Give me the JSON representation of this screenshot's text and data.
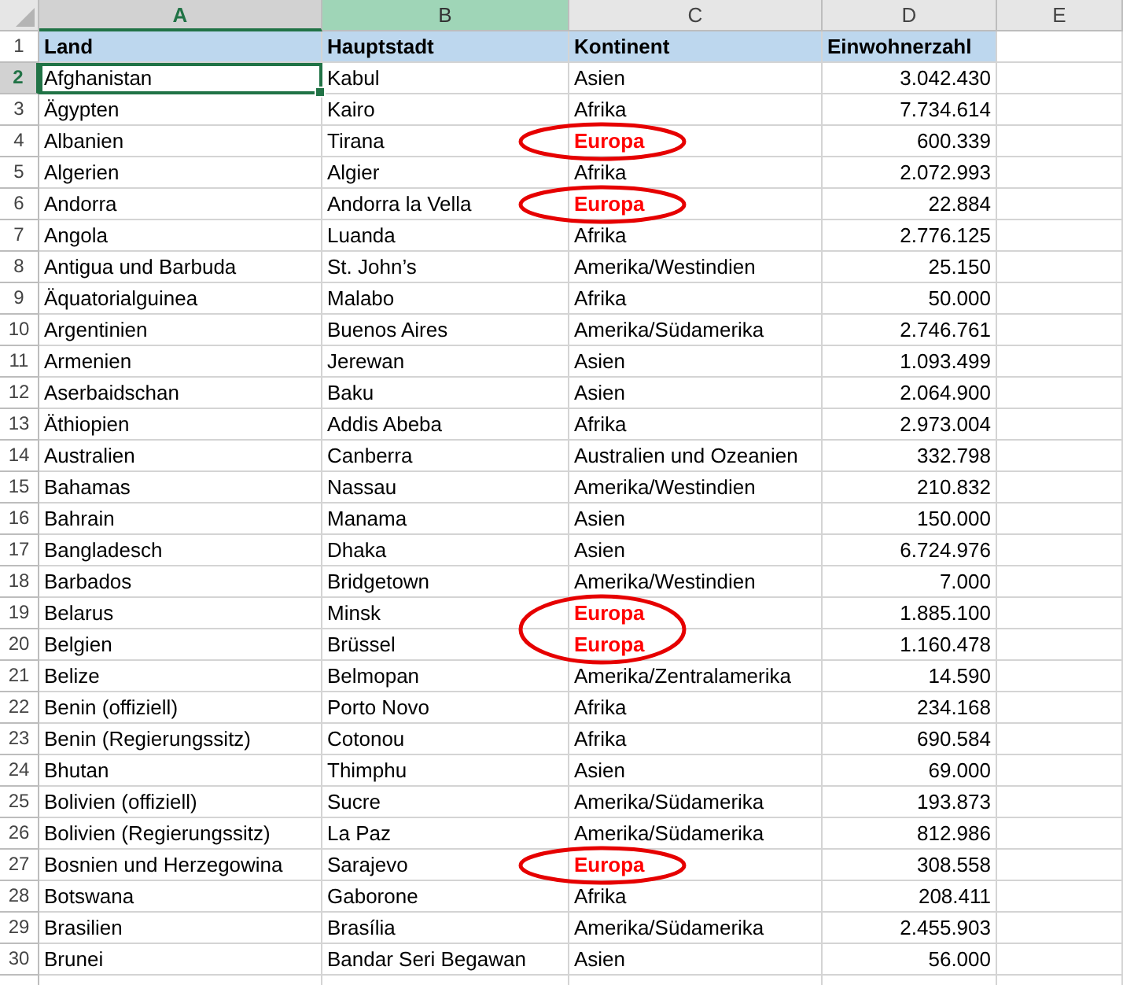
{
  "columns": [
    {
      "label": "A",
      "selected": true,
      "highlighted": false
    },
    {
      "label": "B",
      "selected": false,
      "highlighted": true
    },
    {
      "label": "C",
      "selected": false,
      "highlighted": false
    },
    {
      "label": "D",
      "selected": false,
      "highlighted": false
    },
    {
      "label": "E",
      "selected": false,
      "highlighted": false
    }
  ],
  "rows": [
    {
      "number": "1",
      "kind": "header",
      "selected": false,
      "cells": [
        "Land",
        "Hauptstadt",
        "Kontinent",
        "Einwohnerzahl"
      ]
    },
    {
      "number": "2",
      "kind": "data",
      "selected": true,
      "marked": false,
      "cells": [
        "Afghanistan",
        "Kabul",
        "Asien",
        "3.042.430"
      ]
    },
    {
      "number": "3",
      "kind": "data",
      "selected": false,
      "marked": false,
      "cells": [
        "Ägypten",
        "Kairo",
        "Afrika",
        "7.734.614"
      ]
    },
    {
      "number": "4",
      "kind": "data",
      "selected": false,
      "marked": true,
      "cells": [
        "Albanien",
        "Tirana",
        "Europa",
        "600.339"
      ]
    },
    {
      "number": "5",
      "kind": "data",
      "selected": false,
      "marked": false,
      "cells": [
        "Algerien",
        "Algier",
        "Afrika",
        "2.072.993"
      ]
    },
    {
      "number": "6",
      "kind": "data",
      "selected": false,
      "marked": true,
      "cells": [
        "Andorra",
        "Andorra la Vella",
        "Europa",
        "22.884"
      ]
    },
    {
      "number": "7",
      "kind": "data",
      "selected": false,
      "marked": false,
      "cells": [
        "Angola",
        "Luanda",
        "Afrika",
        "2.776.125"
      ]
    },
    {
      "number": "8",
      "kind": "data",
      "selected": false,
      "marked": false,
      "cells": [
        "Antigua und Barbuda",
        "St. John’s",
        "Amerika/Westindien",
        "25.150"
      ]
    },
    {
      "number": "9",
      "kind": "data",
      "selected": false,
      "marked": false,
      "cells": [
        "Äquatorialguinea",
        "Malabo",
        "Afrika",
        "50.000"
      ]
    },
    {
      "number": "10",
      "kind": "data",
      "selected": false,
      "marked": false,
      "cells": [
        "Argentinien",
        "Buenos Aires",
        "Amerika/Südamerika",
        "2.746.761"
      ]
    },
    {
      "number": "11",
      "kind": "data",
      "selected": false,
      "marked": false,
      "cells": [
        "Armenien",
        "Jerewan",
        "Asien",
        "1.093.499"
      ]
    },
    {
      "number": "12",
      "kind": "data",
      "selected": false,
      "marked": false,
      "cells": [
        "Aserbaidschan",
        "Baku",
        "Asien",
        "2.064.900"
      ]
    },
    {
      "number": "13",
      "kind": "data",
      "selected": false,
      "marked": false,
      "cells": [
        "Äthiopien",
        "Addis Abeba",
        "Afrika",
        "2.973.004"
      ]
    },
    {
      "number": "14",
      "kind": "data",
      "selected": false,
      "marked": false,
      "cells": [
        "Australien",
        "Canberra",
        "Australien und Ozeanien",
        "332.798"
      ]
    },
    {
      "number": "15",
      "kind": "data",
      "selected": false,
      "marked": false,
      "cells": [
        "Bahamas",
        "Nassau",
        "Amerika/Westindien",
        "210.832"
      ]
    },
    {
      "number": "16",
      "kind": "data",
      "selected": false,
      "marked": false,
      "cells": [
        "Bahrain",
        "Manama",
        "Asien",
        "150.000"
      ]
    },
    {
      "number": "17",
      "kind": "data",
      "selected": false,
      "marked": false,
      "cells": [
        "Bangladesch",
        "Dhaka",
        "Asien",
        "6.724.976"
      ]
    },
    {
      "number": "18",
      "kind": "data",
      "selected": false,
      "marked": false,
      "cells": [
        "Barbados",
        "Bridgetown",
        "Amerika/Westindien",
        "7.000"
      ]
    },
    {
      "number": "19",
      "kind": "data",
      "selected": false,
      "marked": true,
      "cells": [
        "Belarus",
        "Minsk",
        "Europa",
        "1.885.100"
      ]
    },
    {
      "number": "20",
      "kind": "data",
      "selected": false,
      "marked": true,
      "cells": [
        "Belgien",
        "Brüssel",
        "Europa",
        "1.160.478"
      ]
    },
    {
      "number": "21",
      "kind": "data",
      "selected": false,
      "marked": false,
      "cells": [
        "Belize",
        "Belmopan",
        "Amerika/Zentralamerika",
        "14.590"
      ]
    },
    {
      "number": "22",
      "kind": "data",
      "selected": false,
      "marked": false,
      "cells": [
        "Benin (offiziell)",
        "Porto Novo",
        "Afrika",
        "234.168"
      ]
    },
    {
      "number": "23",
      "kind": "data",
      "selected": false,
      "marked": false,
      "cells": [
        "Benin (Regierungssitz)",
        "Cotonou",
        "Afrika",
        "690.584"
      ]
    },
    {
      "number": "24",
      "kind": "data",
      "selected": false,
      "marked": false,
      "cells": [
        "Bhutan",
        "Thimphu",
        "Asien",
        "69.000"
      ]
    },
    {
      "number": "25",
      "kind": "data",
      "selected": false,
      "marked": false,
      "cells": [
        "Bolivien (offiziell)",
        "Sucre",
        "Amerika/Südamerika",
        "193.873"
      ]
    },
    {
      "number": "26",
      "kind": "data",
      "selected": false,
      "marked": false,
      "cells": [
        "Bolivien (Regierungssitz)",
        "La Paz",
        "Amerika/Südamerika",
        "812.986"
      ]
    },
    {
      "number": "27",
      "kind": "data",
      "selected": false,
      "marked": true,
      "cells": [
        "Bosnien und Herzegowina",
        "Sarajevo",
        "Europa",
        "308.558"
      ]
    },
    {
      "number": "28",
      "kind": "data",
      "selected": false,
      "marked": false,
      "cells": [
        "Botswana",
        "Gaborone",
        "Afrika",
        "208.411"
      ]
    },
    {
      "number": "29",
      "kind": "data",
      "selected": false,
      "marked": false,
      "cells": [
        "Brasilien",
        "Brasília",
        "Amerika/Südamerika",
        "2.455.903"
      ]
    },
    {
      "number": "30",
      "kind": "data",
      "selected": false,
      "marked": false,
      "cells": [
        "Brunei",
        "Bandar Seri Begawan",
        "Asien",
        "56.000"
      ]
    }
  ]
}
